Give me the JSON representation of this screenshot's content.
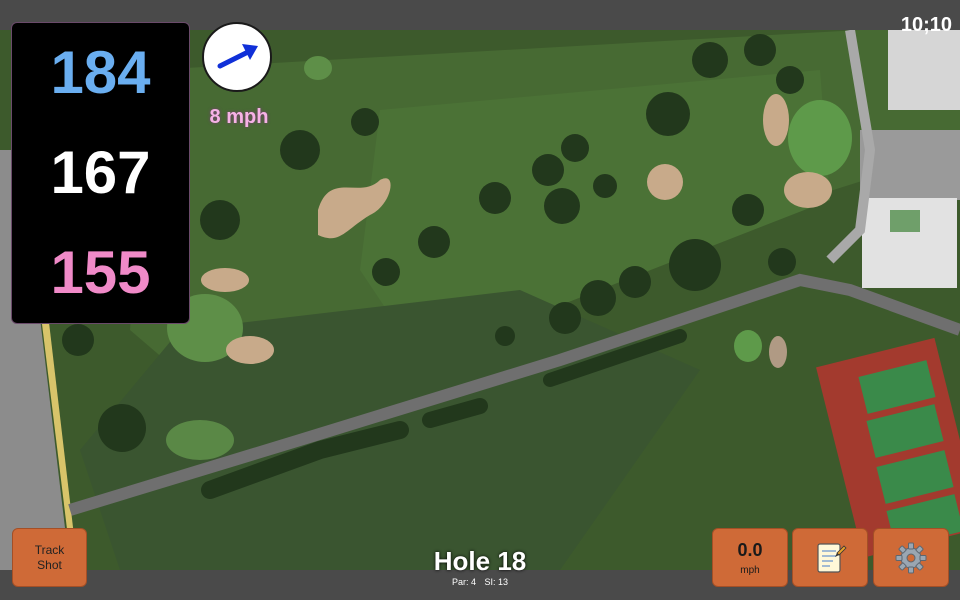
{
  "status": {
    "clock": "10;10"
  },
  "distances": {
    "back": "184",
    "middle": "167",
    "front": "155"
  },
  "wind": {
    "speed_label": "8 mph",
    "direction_icon": "arrow-icon"
  },
  "buttons": {
    "track_shot_line1": "Track",
    "track_shot_line2": "Shot",
    "wind_value": "0.0",
    "wind_unit": "mph",
    "notes_icon": "notepad-icon",
    "settings_icon": "gear-icon"
  },
  "hole": {
    "title": "Hole 18",
    "par": "Par: 4",
    "si": "SI: 13"
  },
  "colors": {
    "back": "#6aaef0",
    "middle": "#ffffff",
    "front": "#f08ac8",
    "button": "#cf6a37",
    "wind_label": "#f6b2e6"
  }
}
